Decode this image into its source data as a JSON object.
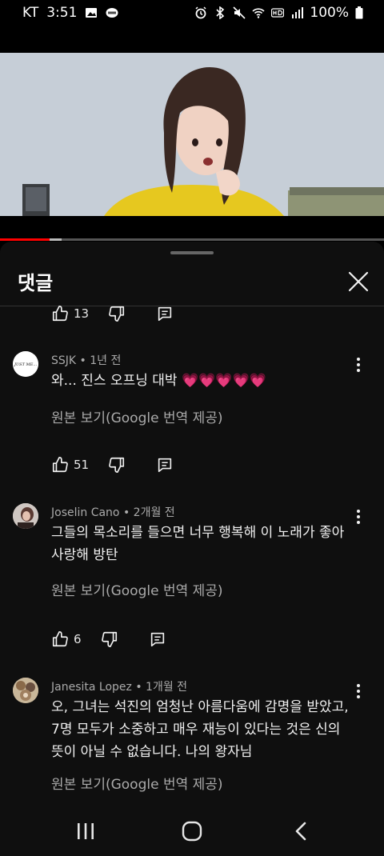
{
  "status_bar": {
    "carrier": "KT",
    "time": "3:51",
    "battery": "100%"
  },
  "video": {
    "progress_percent": 13,
    "buffered_percent": 16
  },
  "comments_panel": {
    "title": "댓글",
    "top_action_row": {
      "likes": "13"
    },
    "comments": [
      {
        "author": "SSJK",
        "time": "1년 전",
        "text": "와... 진스 오프닝 대박 💗💗💗💗💗",
        "translate_label": "원본 보기(Google 번역 제공)",
        "likes": "51",
        "avatar_text": "JUST ME..."
      },
      {
        "author": "Joselin Cano",
        "time": "2개월 전",
        "text_lines": [
          "그들의 목소리를 들으면 너무 행복해 이 노래가 좋아",
          "사랑해 방탄"
        ],
        "translate_label": "원본 보기(Google 번역 제공)",
        "likes": "6"
      },
      {
        "author": "Janesita Lopez",
        "time": "1개월 전",
        "text_lines": [
          "오, 그녀는 석진의 엄청난 아름다움에 감명을 받았고,",
          "7명 모두가 소중하고 매우 재능이 있다는 것은 신의",
          "뜻이 아닐 수 없습니다. 나의 왕자님"
        ],
        "translate_label": "원본 보기(Google 번역 제공)"
      }
    ]
  },
  "colors": {
    "sheet_bg": "#0f0f0f",
    "progress": "#ff0000",
    "secondary_text": "#aaaaaa"
  }
}
